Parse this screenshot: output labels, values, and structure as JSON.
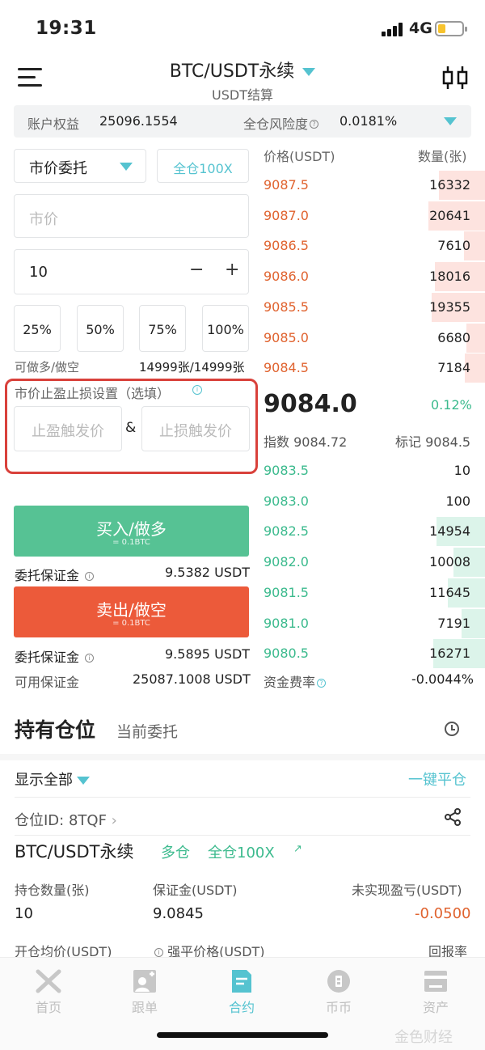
{
  "status_bar": {
    "time": "19:31",
    "network": "4G"
  },
  "header": {
    "title": "BTC/USDT永续",
    "subtitle": "USDT结算"
  },
  "info_bar": {
    "equity_label": "账户权益",
    "equity_value": "25096.1554",
    "risk_label": "全仓风险度",
    "risk_value": "0.0181%"
  },
  "order": {
    "type": "市价委托",
    "leverage": "全仓100X",
    "price_placeholder": "市价",
    "quantity": "10",
    "minus": "−",
    "plus": "+",
    "percents": [
      "25%",
      "50%",
      "75%",
      "100%"
    ],
    "available_label": "可做多/做空",
    "available_value": "14999张/14999张",
    "tpsl_header": "市价止盈止损设置（选填）",
    "tp_placeholder": "止盈触发价",
    "amp": "&",
    "sl_placeholder": "止损触发价",
    "buy_label": "买入/做多",
    "buy_sub": "= 0.1BTC",
    "buy_margin_label": "委托保证金",
    "buy_margin_value": "9.5382 USDT",
    "sell_label": "卖出/做空",
    "sell_sub": "= 0.1BTC",
    "sell_margin_label": "委托保证金",
    "sell_margin_value": "9.5895 USDT",
    "usable_margin_label": "可用保证金",
    "usable_margin_value": "25087.1008 USDT"
  },
  "orderbook": {
    "price_header": "价格(USDT)",
    "qty_header": "数量(张)",
    "asks": [
      {
        "price": "9087.5",
        "qty": "16332",
        "depth": 0.82
      },
      {
        "price": "9087.0",
        "qty": "20641",
        "depth": 1.0
      },
      {
        "price": "9086.5",
        "qty": "7610",
        "depth": 0.37
      },
      {
        "price": "9086.0",
        "qty": "18016",
        "depth": 0.88
      },
      {
        "price": "9085.5",
        "qty": "19355",
        "depth": 0.94
      },
      {
        "price": "9085.0",
        "qty": "6680",
        "depth": 0.33
      },
      {
        "price": "9084.5",
        "qty": "7184",
        "depth": 0.35
      }
    ],
    "last_price": "9084.0",
    "change": "0.12%",
    "index_label": "指数",
    "index_value": "9084.72",
    "mark_label": "标记",
    "mark_value": "9084.5",
    "bids": [
      {
        "price": "9083.5",
        "qty": "10",
        "depth": 0.0
      },
      {
        "price": "9083.0",
        "qty": "100",
        "depth": 0.0
      },
      {
        "price": "9082.5",
        "qty": "14954",
        "depth": 0.85
      },
      {
        "price": "9082.0",
        "qty": "10008",
        "depth": 0.56
      },
      {
        "price": "9081.5",
        "qty": "11645",
        "depth": 0.66
      },
      {
        "price": "9081.0",
        "qty": "7191",
        "depth": 0.41
      },
      {
        "price": "9080.5",
        "qty": "16271",
        "depth": 0.92
      }
    ],
    "funding_label": "资金费率",
    "funding_value": "-0.0044%"
  },
  "positions": {
    "tab_holding": "持有仓位",
    "tab_orders": "当前委托",
    "show_all": "显示全部",
    "close_all": "一键平仓",
    "position_id": "仓位ID: 8TQF",
    "chevron": "›",
    "pair": "BTC/USDT永续",
    "side": "多仓",
    "margin_mode": "全仓100X",
    "qty_label": "持仓数量(张)",
    "qty_value": "10",
    "margin_label": "保证金(USDT)",
    "margin_value": "9.0845",
    "pnl_label": "未实现盈亏(USDT)",
    "pnl_value": "-0.0500",
    "pnl_color": "#e0632f",
    "open_label": "开仓均价(USDT)",
    "liq_label": "强平价格(USDT)",
    "roe_label": "回报率"
  },
  "tabbar": {
    "items": [
      {
        "label": "首页",
        "icon": "home-x-icon"
      },
      {
        "label": "跟单",
        "icon": "copy-trade-icon"
      },
      {
        "label": "合约",
        "icon": "contract-icon",
        "active": true
      },
      {
        "label": "币币",
        "icon": "coin-icon"
      },
      {
        "label": "资产",
        "icon": "assets-icon"
      }
    ]
  },
  "watermark": "金色财经",
  "colors": {
    "accent": "#55c3d0",
    "buy": "#56c294",
    "sell": "#ec5a3a",
    "ask_text": "#e0632f",
    "bid_text": "#3bba8d",
    "highlight_border": "#d9413b"
  }
}
